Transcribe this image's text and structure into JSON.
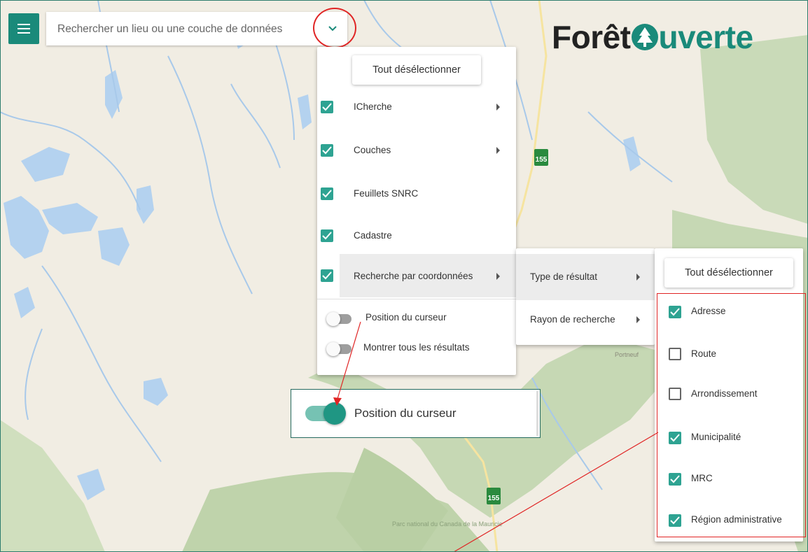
{
  "search": {
    "placeholder": "Rechercher un lieu ou une couche de données",
    "menu_icon": "hamburger-icon",
    "expand_icon": "chevron-down-icon"
  },
  "logo": {
    "part1": "Forêt",
    "part2": "uverte",
    "symbol": "tree-icon"
  },
  "map": {
    "park_label": "Parc national du Canada de la Mauricie",
    "place_label": "Portneuf",
    "route_shield": "155"
  },
  "menu1": {
    "deselect_label": "Tout désélectionner",
    "items": [
      {
        "label": "ICherche",
        "checked": true,
        "submenu": true
      },
      {
        "label": "Couches",
        "checked": true,
        "submenu": true
      },
      {
        "label": "Feuillets SNRC",
        "checked": true,
        "submenu": false
      },
      {
        "label": "Cadastre",
        "checked": true,
        "submenu": false
      },
      {
        "label": "Recherche par coordonnées",
        "checked": true,
        "submenu": true
      }
    ],
    "toggles": [
      {
        "label": "Position du curseur",
        "on": false
      },
      {
        "label": "Montrer tous les résultats",
        "on": false
      }
    ]
  },
  "menu2": {
    "items": [
      {
        "label": "Type de résultat"
      },
      {
        "label": "Rayon de recherche"
      }
    ]
  },
  "menu3": {
    "deselect_label": "Tout désélectionner",
    "items": [
      {
        "label": "Adresse",
        "checked": true
      },
      {
        "label": "Route",
        "checked": false
      },
      {
        "label": "Arrondissement",
        "checked": false
      },
      {
        "label": "Municipalité",
        "checked": true
      },
      {
        "label": "MRC",
        "checked": true
      },
      {
        "label": "Région administrative",
        "checked": true
      }
    ]
  },
  "zoom": {
    "label": "Position du curseur",
    "on": true
  },
  "colors": {
    "accent": "#1a8a7a",
    "check": "#2ea392",
    "annotation": "#e02424"
  }
}
